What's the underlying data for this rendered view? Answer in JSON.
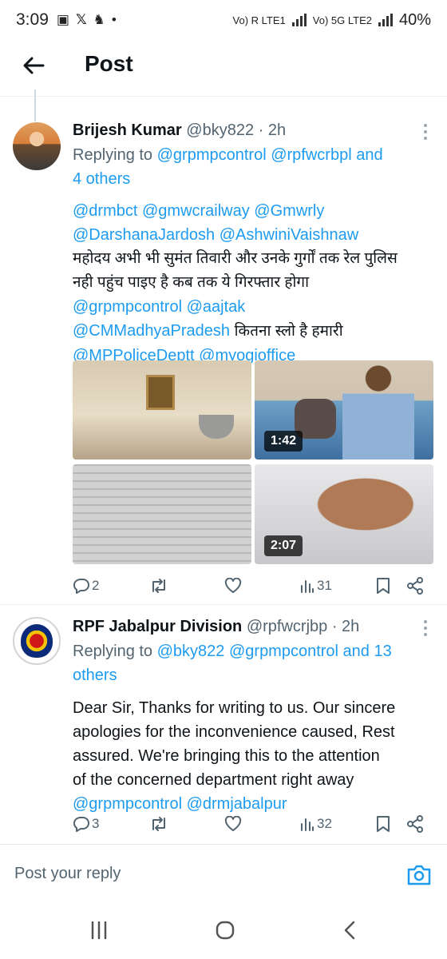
{
  "status_bar": {
    "time": "3:09",
    "sim1": "Vo) R LTE1",
    "sim2": "Vo) 5G LTE2",
    "battery": "40%"
  },
  "header": {
    "title": "Post"
  },
  "tweet1": {
    "name": "Brijesh Kumar",
    "handle": "@bky822",
    "time": "· 2h",
    "reply_prefix": "Replying to",
    "reply_targets_line1": "@grpmpcontrol @rpfwcrbpl and",
    "reply_targets_line2": "4 others",
    "mentions_line1": "@drmbct @gmwcrailway @Gmwrly",
    "mentions_line2": "@DarshanaJardosh @AshwiniVaishnaw",
    "hindi_line1": "महोदय अभी भी सुमंत तिवारी और उनके गुर्गों तक रेल पुलिस",
    "hindi_line2": "नही पहुंच पाइए है कब तक ये गिरफ्तार होगा",
    "mentions_line3": "@grpmpcontrol @aajtak",
    "mention_line4": "@CMMadhyaPradesh",
    "hindi_line3": "कितना स्लो है हमारी",
    "mentions_line5": "@MPPoliceDeptt @myogioffice",
    "media_durations": [
      "1:42",
      "2:07"
    ],
    "replies": "2",
    "views": "31"
  },
  "tweet2": {
    "name": "RPF Jabalpur Division",
    "handle": "@rpfwcrjbp",
    "time": "· 2h",
    "reply_prefix": "Replying to",
    "reply_targets_line1": "@bky822 @grpmpcontrol and 13",
    "reply_targets_line2": "others",
    "body_line1": "Dear Sir, Thanks for writing to us. Our sincere",
    "body_line2": "apologies for the inconvenience caused, Rest",
    "body_line3": "assured. We're bringing this to the attention",
    "body_line4": "of the concerned department right away",
    "mentions": "@grpmpcontrol @drmjabalpur",
    "replies": "3",
    "views": "32"
  },
  "composer": {
    "placeholder": "Post your reply"
  },
  "colors": {
    "link": "#1d9bf0",
    "secondary_text": "#536471",
    "primary_text": "#0f1419"
  },
  "icons": [
    "back-arrow-icon",
    "reply-icon",
    "repost-icon",
    "like-icon",
    "views-icon",
    "bookmark-icon",
    "share-icon",
    "camera-icon",
    "more-icon"
  ]
}
